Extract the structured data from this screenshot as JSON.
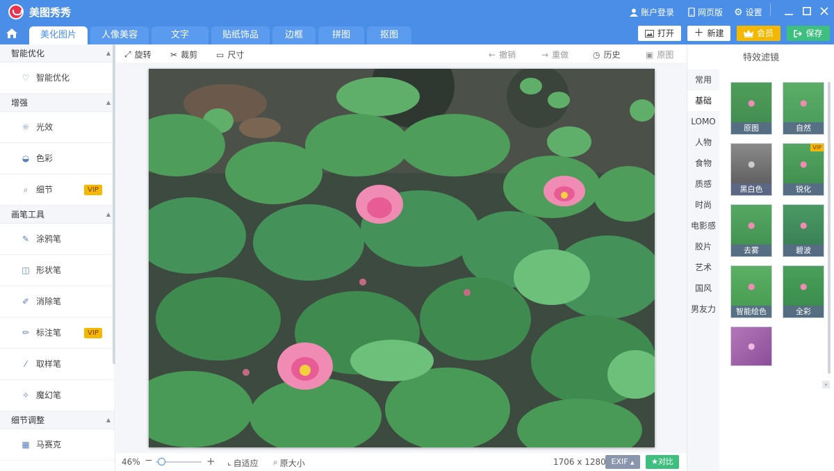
{
  "app": {
    "title": "美图秀秀"
  },
  "titlebar": {
    "login": "账户登录",
    "web": "网页版",
    "settings": "设置"
  },
  "tabs": [
    "美化图片",
    "人像美容",
    "文字",
    "贴纸饰品",
    "边框",
    "拼图",
    "抠图"
  ],
  "top_buttons": {
    "open": "打开",
    "new": "新建",
    "vip": "会员",
    "save": "保存"
  },
  "sidebar": {
    "sections": [
      {
        "title": "智能优化",
        "items": [
          {
            "label": "智能优化",
            "icon": "bulb-icon"
          }
        ]
      },
      {
        "title": "增强",
        "items": [
          {
            "label": "光效",
            "icon": "sun-icon"
          },
          {
            "label": "色彩",
            "icon": "palette-icon"
          },
          {
            "label": "细节",
            "icon": "magnifier-icon",
            "badge": "VIP"
          }
        ]
      },
      {
        "title": "画笔工具",
        "items": [
          {
            "label": "涂鸦笔",
            "icon": "scribble-icon"
          },
          {
            "label": "形状笔",
            "icon": "shape-icon"
          },
          {
            "label": "消除笔",
            "icon": "eraser-icon"
          },
          {
            "label": "标注笔",
            "icon": "pen-icon",
            "badge": "VIP"
          },
          {
            "label": "取样笔",
            "icon": "dropper-icon"
          },
          {
            "label": "魔幻笔",
            "icon": "magic-icon"
          }
        ]
      },
      {
        "title": "细节调整",
        "items": [
          {
            "label": "马赛克",
            "icon": "mosaic-icon"
          }
        ]
      }
    ]
  },
  "edit_toolbar": {
    "rotate": "旋转",
    "crop": "裁剪",
    "size": "尺寸",
    "undo": "撤销",
    "redo": "重做",
    "history": "历史",
    "original": "原图"
  },
  "status": {
    "zoom": "46%",
    "fit": "自适应",
    "actual": "原大小",
    "dimensions": "1706 x 1280",
    "exif": "EXIF",
    "compare": "对比"
  },
  "filters_panel": {
    "title": "特效滤镜",
    "categories": [
      "常用",
      "基础",
      "LOMO",
      "人物",
      "食物",
      "质感",
      "时尚",
      "电影感",
      "胶片",
      "艺术",
      "国风",
      "男友力"
    ],
    "active_category": "基础",
    "thumbs": [
      {
        "label": "原图"
      },
      {
        "label": "自然"
      },
      {
        "label": "黑白色"
      },
      {
        "label": "锐化",
        "badge": "VIP"
      },
      {
        "label": "去雾"
      },
      {
        "label": "碧波"
      },
      {
        "label": "智能绘色"
      },
      {
        "label": "全彩"
      },
      {
        "label": ""
      }
    ]
  },
  "colors": {
    "brand": "#4a8ee8",
    "vip": "#f5b800",
    "save": "#3fbf7f"
  }
}
